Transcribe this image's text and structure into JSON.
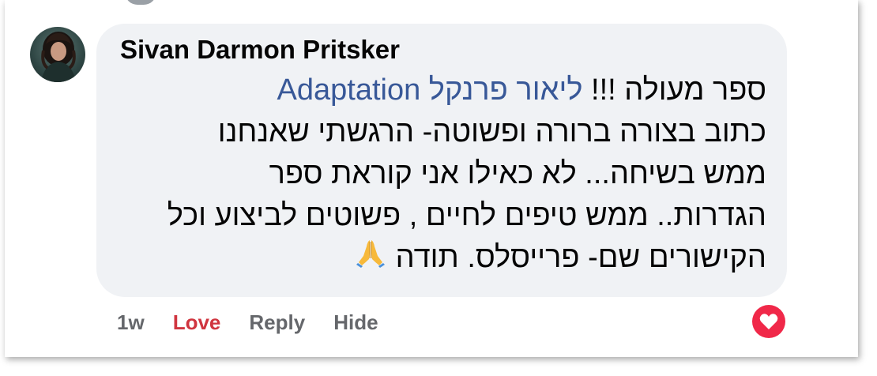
{
  "comment": {
    "author": "Sivan Darmon Pritsker",
    "lines": [
      {
        "mention": "ליאור פרנקל Adaptation",
        "text": "ספר מעולה !!! "
      },
      {
        "text": "כתוב בצורה ברורה ופשוטה- הרגשתי שאנחנו"
      },
      {
        "text": "ממש בשיחה... לא כאילו אני קוראת ספר"
      },
      {
        "text": "הגדרות.. ממש טיפים לחיים , פשוטים לביצוע וכל"
      },
      {
        "text": "הקישורים שם- פרייסלס. תודה"
      }
    ],
    "emoji_icon": "folded-hands-icon"
  },
  "actions": {
    "time": "1w",
    "love_label": "Love",
    "reply_label": "Reply",
    "hide_label": "Hide"
  },
  "reaction": {
    "icon": "heart-icon",
    "color": "#f02849"
  },
  "colors": {
    "bubble": "#f0f2f5",
    "mention": "#385898",
    "love": "#d0353f",
    "secondary": "#65676b"
  }
}
